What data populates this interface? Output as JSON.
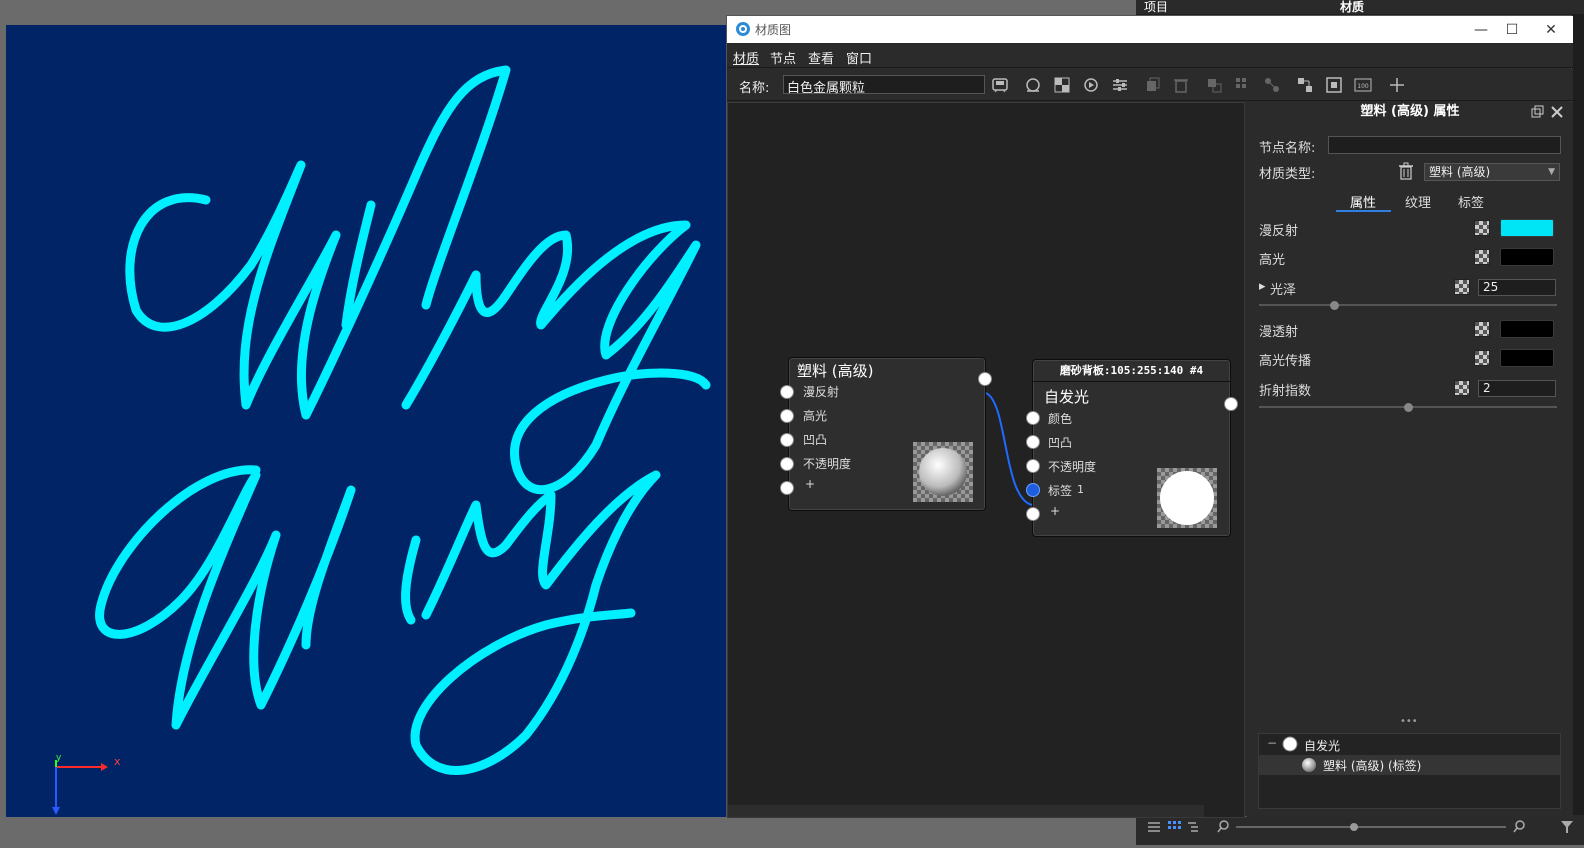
{
  "right_panel": {
    "header_left": "项目",
    "header_right": "材质"
  },
  "window": {
    "title": "材质图",
    "min": "—",
    "max": "☐",
    "close": "✕"
  },
  "menu": [
    "材质",
    "节点",
    "查看",
    "窗口"
  ],
  "toolbar": {
    "name_label": "名称:",
    "name_value": "白色金属颗粒"
  },
  "node_plastic": {
    "title": "塑料 (高级)",
    "inputs": [
      "漫反射",
      "高光",
      "凹凸",
      "不透明度",
      "+"
    ]
  },
  "node_emissive": {
    "header": "磨砂背板:105:255:140 #4",
    "title": "自发光",
    "inputs": [
      "颜色",
      "凹凸",
      "不透明度",
      "标签",
      "+"
    ],
    "tag_index": "1"
  },
  "props": {
    "title": "塑料 (高级) 属性",
    "node_name_label": "节点名称:",
    "node_name_value": "",
    "material_type_label": "材质类型:",
    "material_type_value": "塑料 (高级)",
    "tabs": [
      "属性",
      "纹理",
      "标签"
    ],
    "active_tab": "属性",
    "diffuse_label": "漫反射",
    "diffuse_color": "#00e5f5",
    "specular_label": "高光",
    "specular_color": "#000000",
    "gloss_label": "光泽",
    "gloss_value": "25",
    "transmission_label": "漫透射",
    "transmission_color": "#000000",
    "specular_transmission_label": "高光传播",
    "specular_transmission_color": "#000000",
    "ior_label": "折射指数",
    "ior_value": "2",
    "gloss_fraction": 0.25,
    "ior_fraction": 0.5
  },
  "tree": {
    "root_label": "自发光",
    "child_label": "塑料 (高级) (标签)",
    "collapse": "−"
  },
  "more_dots": "•••",
  "viewport": {
    "text_color": "#00f0ff",
    "background": "#002466",
    "axis_x": "x",
    "axis_y": "y"
  }
}
